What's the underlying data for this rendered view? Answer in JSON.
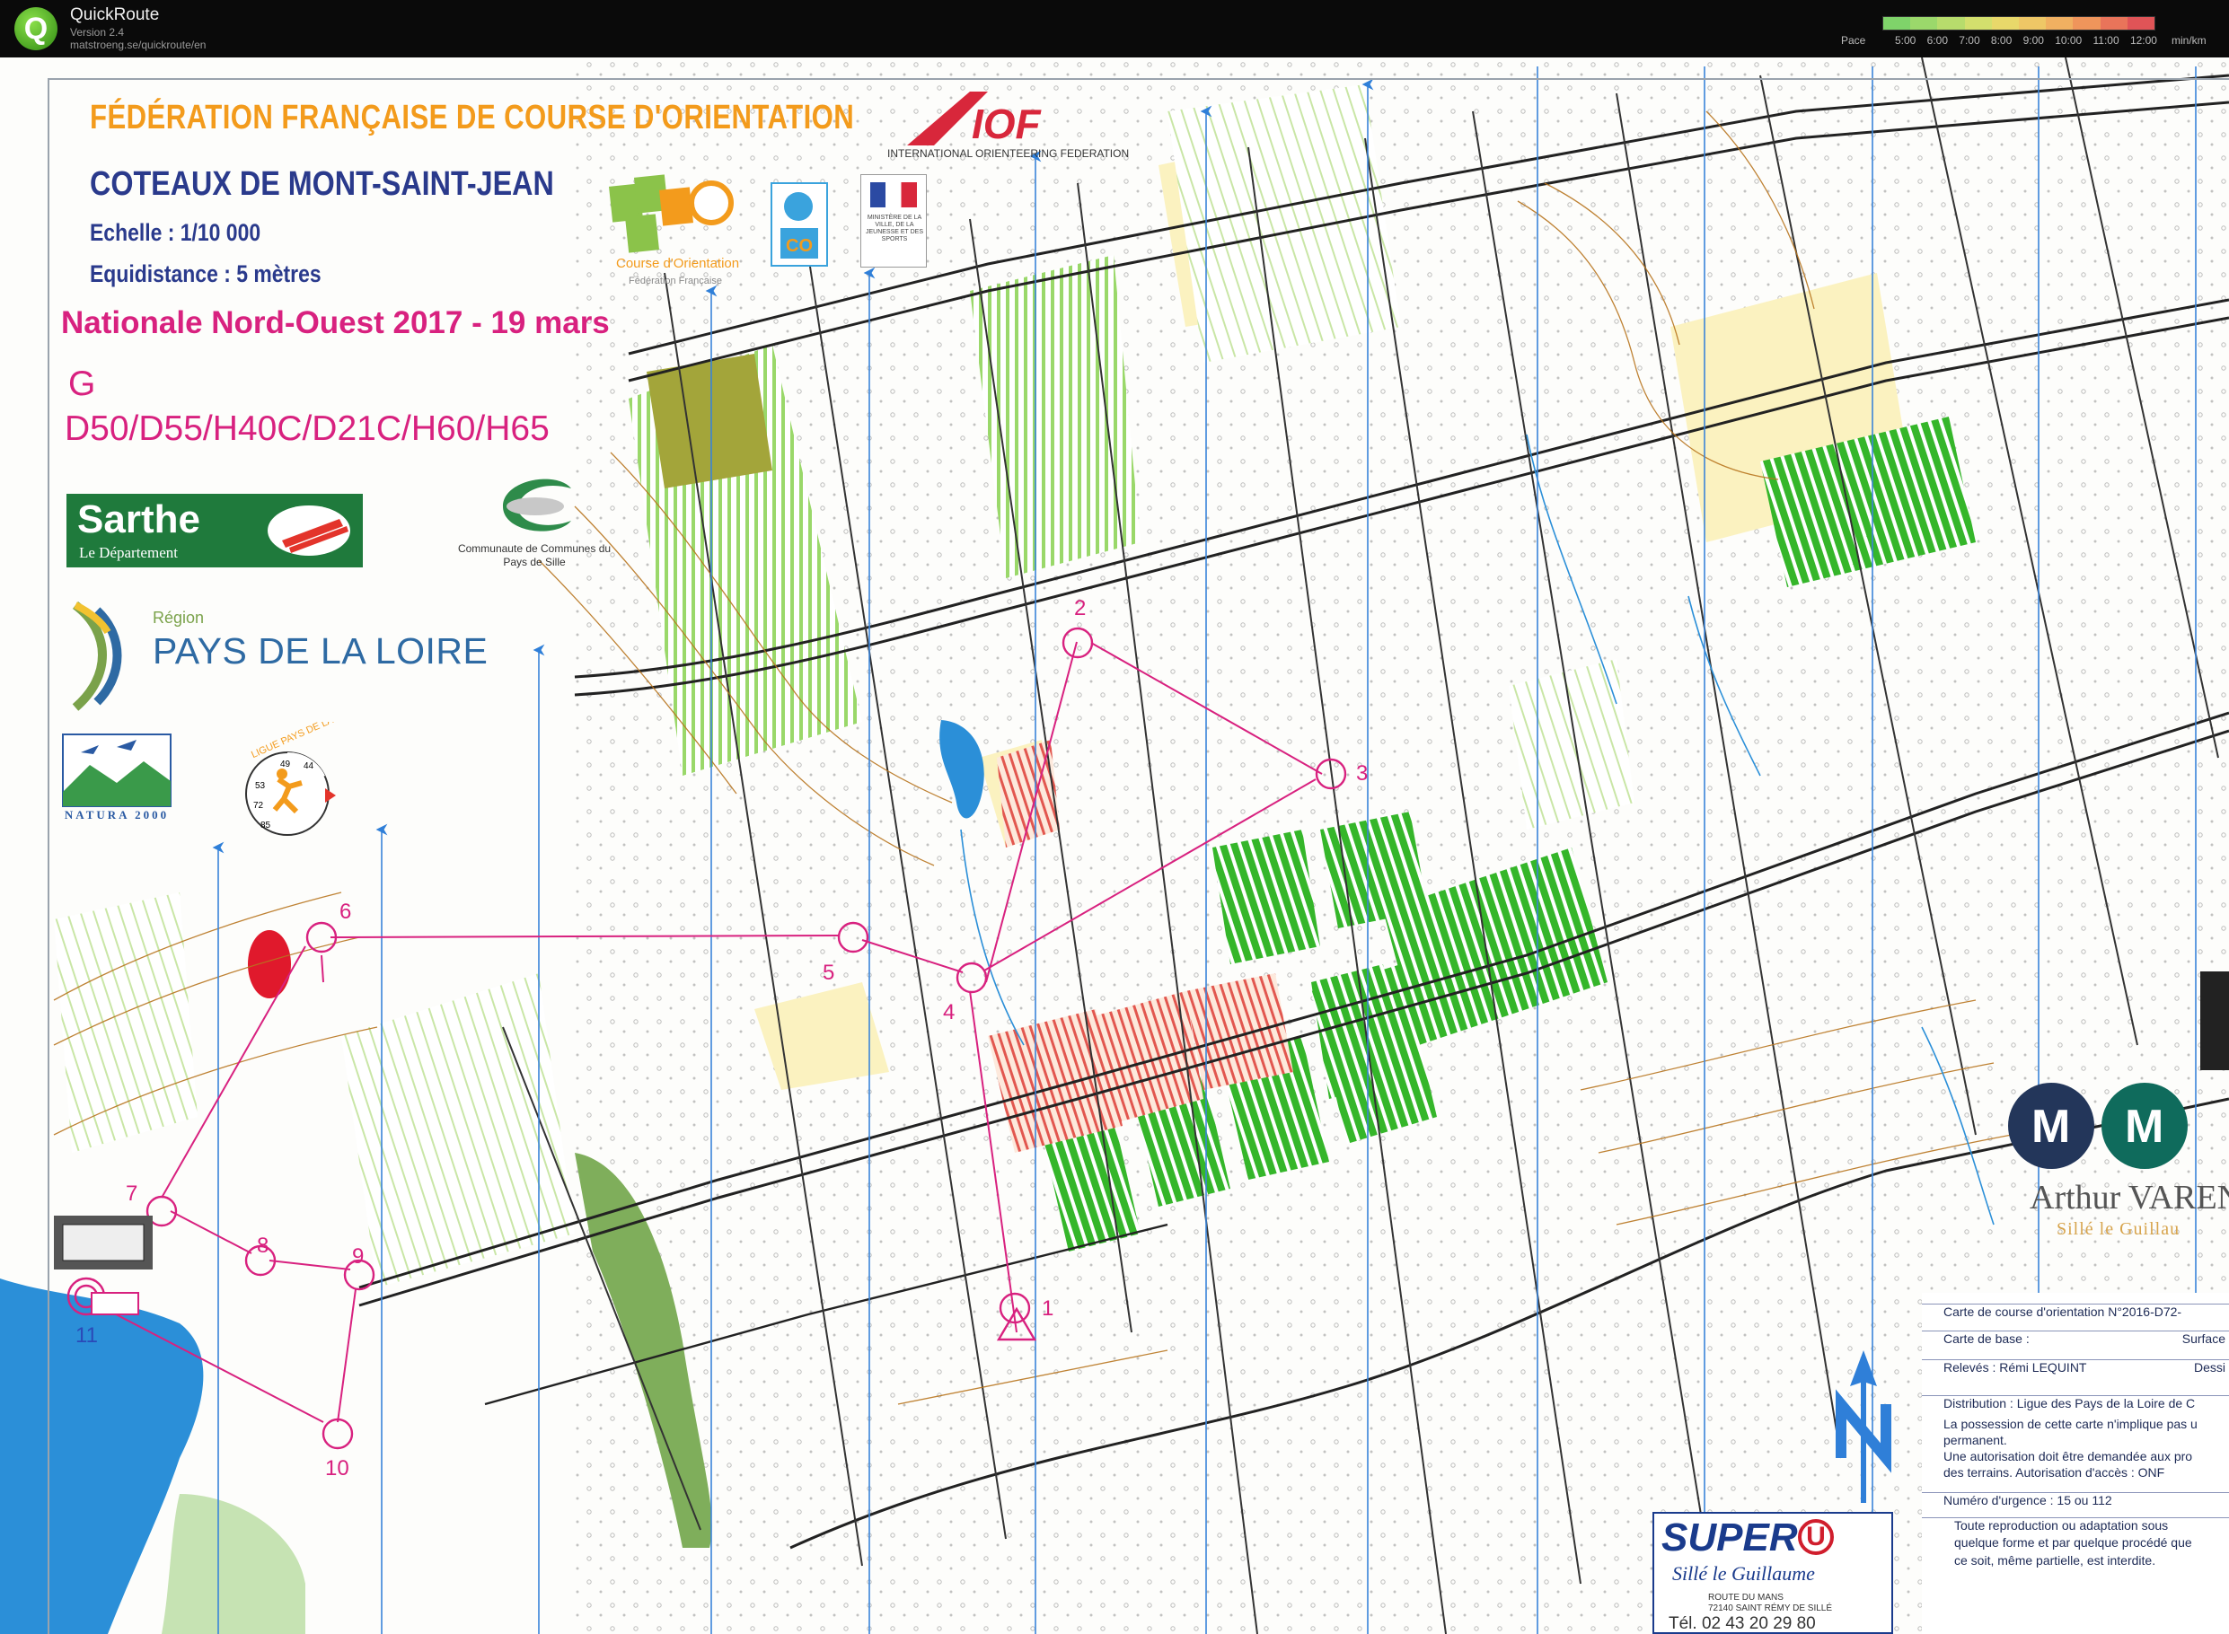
{
  "window": {
    "app_name": "QuickRoute",
    "version": "Version 2.4",
    "url": "matstroeng.se/quickroute/en",
    "icon": "quickroute-q-icon"
  },
  "pace_legend": {
    "label": "Pace",
    "ticks": [
      "5:00",
      "6:00",
      "7:00",
      "8:00",
      "9:00",
      "10:00",
      "11:00",
      "12:00"
    ],
    "unit": "min/km",
    "colors": [
      "#7fd36a",
      "#9bd86b",
      "#b7dc6c",
      "#d3df6d",
      "#e8d86a",
      "#eec766",
      "#f0b061",
      "#ef955b",
      "#e9745a",
      "#e05457"
    ]
  },
  "map": {
    "federation_title": "FÉDÉRATION FRANÇAISE DE COURSE D'ORIENTATION",
    "map_name": "COTEAUX DE MONT-SAINT-JEAN",
    "scale": "Echelle : 1/10 000",
    "equidistance": "Equidistance : 5 mètres",
    "event": "Nationale Nord-Ouest 2017 - 19 mars",
    "course": "G",
    "classes": "D50/D55/H40C/D21C/H60/H65",
    "colors": {
      "open_land": "#fbf3c4",
      "green": "#8bd44e",
      "dark_green": "#2fa31e",
      "water": "#2b8fd8",
      "course": "#d8217f",
      "contour": "#b8751f",
      "north_line": "#3a84d9"
    },
    "controls": [
      {
        "number": "1"
      },
      {
        "number": "2"
      },
      {
        "number": "3"
      },
      {
        "number": "4"
      },
      {
        "number": "5"
      },
      {
        "number": "6"
      },
      {
        "number": "7"
      },
      {
        "number": "8"
      },
      {
        "number": "9"
      },
      {
        "number": "10"
      },
      {
        "number": "11"
      }
    ]
  },
  "logos": {
    "iof_text": "INTERNATIONAL ORIENTEERING FEDERATION",
    "iof_mark": "IOF",
    "ffco_mark": "FFCO",
    "ffco_caption": "Course d'Orientation",
    "ffco_sub": "Fédération Française",
    "co_mark": "CO",
    "ministry_text": "MINISTÈRE DE LA VILLE, DE LA JEUNESSE ET DES SPORTS",
    "sarthe_name": "Sarthe",
    "sarthe_sub": "Le Département",
    "cc_text": "Communaute de Communes du Pays de Sille",
    "region_label": "Région",
    "region_name": "PAYS DE LA LOIRE",
    "natura_text": "NATURA 2000",
    "ligue_text": "LIGUE PAYS DE LA LOIRE",
    "ligue_numbers": [
      "49",
      "44",
      "53",
      "72",
      "85"
    ],
    "metro_letter": "M",
    "metro_name": "Arthur VAREN",
    "metro_town": "Sillé le Guillau",
    "superu_name": "SUPER",
    "superu_u": "U",
    "superu_town": "Sillé le Guillaume",
    "superu_addr1": "ROUTE DU MANS",
    "superu_addr2": "72140 SAINT RÉMY DE SILLÉ",
    "superu_tel": "Tél. 02 43 20 29 80"
  },
  "info_box": {
    "carte_num": "Carte de course d'orientation N°2016-D72-",
    "carte_base": "Carte de base :",
    "carte_base_right": "Surface",
    "releves": "Relevés : Rémi LEQUINT",
    "releves_right": "Dessi",
    "distribution": "Distribution : Ligue des Pays de la Loire de C",
    "possession1": "La possession de cette carte n'implique pas u",
    "possession2": "permanent.",
    "autorisation1": "Une autorisation doit être demandée aux pro",
    "autorisation2": "des terrains.     Autorisation d'accès : ONF",
    "urgence": "Numéro d'urgence : 15 ou 112",
    "repro1": "Toute reproduction ou adaptation sous",
    "repro2": "quelque forme et par quelque procédé que",
    "repro3": "ce soit, même partielle, est interdite."
  }
}
